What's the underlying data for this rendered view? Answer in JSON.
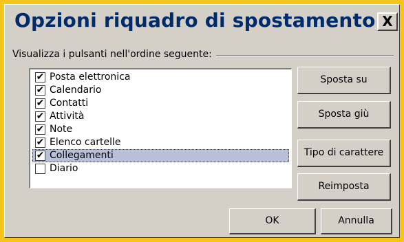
{
  "dialog": {
    "title": "Opzioni riquadro di spostamento",
    "close_label": "X"
  },
  "group": {
    "label": "Visualizza i pulsanti nell'ordine seguente:"
  },
  "list": {
    "items": [
      {
        "label": "Posta elettronica",
        "checked": true,
        "mark": "✔"
      },
      {
        "label": "Calendario",
        "checked": true,
        "mark": "✔"
      },
      {
        "label": "Contatti",
        "checked": true,
        "mark": "✔"
      },
      {
        "label": "Attività",
        "checked": true,
        "mark": "✔"
      },
      {
        "label": "Note",
        "checked": true,
        "mark": "✔"
      },
      {
        "label": "Elenco cartelle",
        "checked": true,
        "mark": "✔"
      },
      {
        "label": "Collegamenti",
        "checked": true,
        "mark": "✔",
        "selected": true
      },
      {
        "label": "Diario",
        "checked": false,
        "mark": ""
      }
    ]
  },
  "buttons": {
    "move_up": "Sposta su",
    "move_down": "Sposta giù",
    "font": "Tipo di carattere",
    "reset": "Reimposta",
    "ok": "OK",
    "cancel": "Annulla"
  },
  "colors": {
    "outer_frame": "#f5c518",
    "dialog_face": "#d4d0c8",
    "title_text": "#002b6b",
    "selection": "#b7bfd9"
  }
}
